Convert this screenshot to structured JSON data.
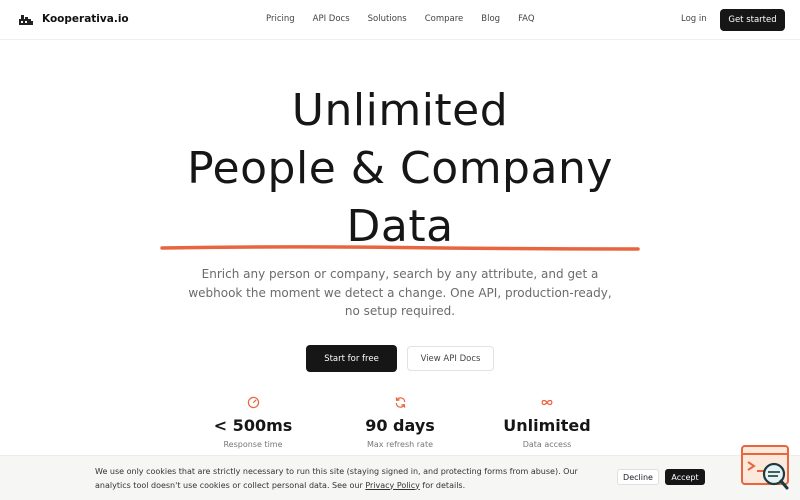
{
  "header": {
    "brand": "Kooperativa.io",
    "nav": [
      "Pricing",
      "API Docs",
      "Solutions",
      "Compare",
      "Blog",
      "FAQ"
    ],
    "login": "Log in",
    "cta": "Get started"
  },
  "hero": {
    "title_lines": [
      "Unlimited",
      "People & Company",
      "Data"
    ],
    "subtitle": "Enrich any person or company, search by any attribute, and get a webhook the moment we detect a change. One API, production-ready, no setup required.",
    "primary_button": "Start for free",
    "secondary_button": "View API Docs"
  },
  "stats": [
    {
      "icon": "gauge-icon",
      "value": "< 500ms",
      "label": "Response time"
    },
    {
      "icon": "refresh-icon",
      "value": "90 days",
      "label": "Max refresh rate"
    },
    {
      "icon": "infinity-icon",
      "value": "Unlimited",
      "label": "Data access"
    }
  ],
  "cookie": {
    "text_before": "We use only cookies that are strictly necessary to run this site (staying signed in, and protecting forms from abuse). Our analytics tool doesn't use cookies or collect personal data. See our ",
    "link": "Privacy Policy",
    "text_after": " for details.",
    "decline": "Decline",
    "accept": "Accept"
  },
  "colors": {
    "accent": "#e8663f",
    "primary_dark": "#161616"
  }
}
